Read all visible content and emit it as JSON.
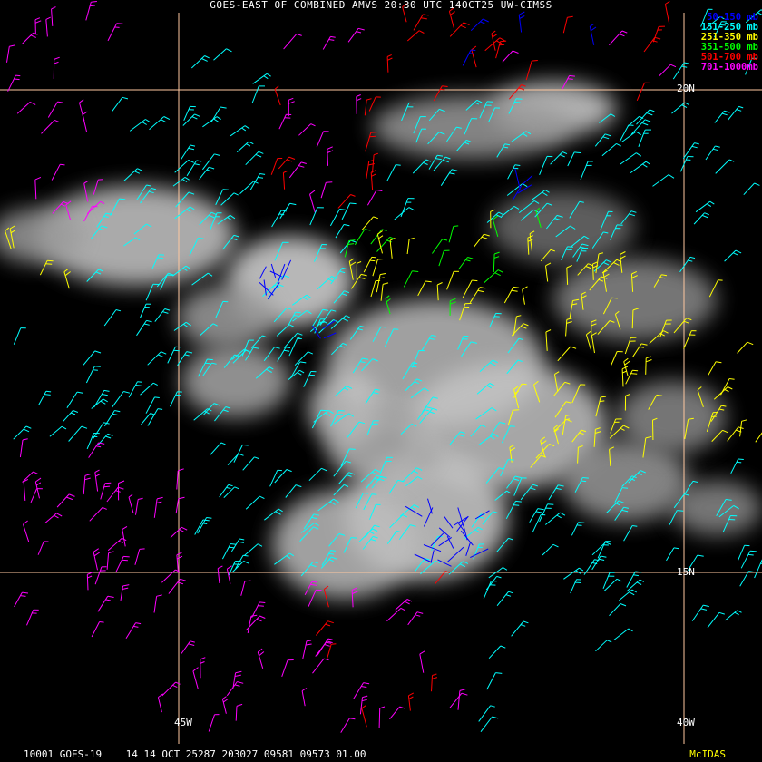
{
  "title": "GOES-EAST OF COMBINED AMVS 20:30 UTC 14OCT25 UW-CIMSS",
  "legend": [
    {
      "label": "50-150 mb",
      "color": "#0000ff"
    },
    {
      "label": "151-250 mb",
      "color": "#00ffff"
    },
    {
      "label": "251-350 mb",
      "color": "#ffff00"
    },
    {
      "label": "351-500 mb",
      "color": "#00ff00"
    },
    {
      "label": "501-700 mb",
      "color": "#ff0000"
    },
    {
      "label": "701-1000mb",
      "color": "#ff00ff"
    }
  ],
  "grid": {
    "lat_labels": [
      "20N",
      "15N"
    ],
    "lon_labels": [
      "45W",
      "40W"
    ],
    "line_color": "#ffc8a0"
  },
  "footer": "10001 GOES-19    14 14 OCT 25287 203027 09581 09573 01.00",
  "mcidas_label": "McIDAS"
}
